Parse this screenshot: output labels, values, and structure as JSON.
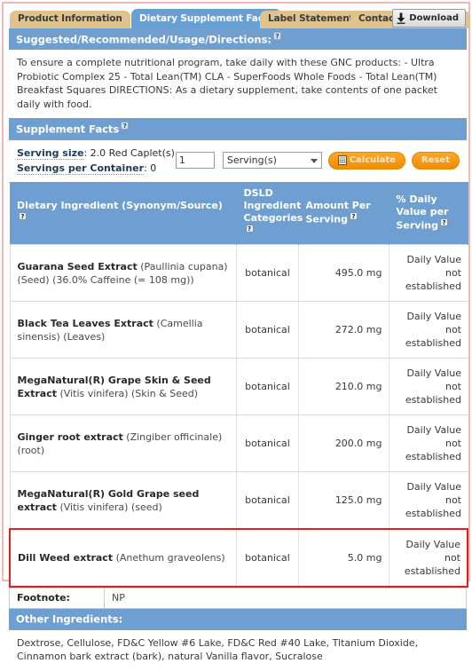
{
  "tabs": [
    {
      "label": "Product Information",
      "active": false
    },
    {
      "label": "Dietary Supplement Facts",
      "active": true
    },
    {
      "label": "Label Statements",
      "active": false
    },
    {
      "label": "Contact Information",
      "active": false
    }
  ],
  "download": {
    "label": "Download",
    "icon": "download-icon"
  },
  "sections": {
    "directions": {
      "title": "Suggested/Recommended/Usage/Directions:",
      "help": "?",
      "text": "To ensure a complete nutritional program, take daily with these GNC products: - Ultra Probiotic Complex 25 - Total Lean(TM) CLA - SuperFoods Whole Foods - Total Lean(TM) Breakfast Squares DIRECTIONS: As a dietary supplement, take contents of one packet daily with food."
    },
    "supplement_facts": {
      "title": "Supplement Facts",
      "help": "?"
    },
    "other_ingredients": {
      "title": "Other Ingredients:",
      "text": "Dextrose, Cellulose, FD&C Yellow #6 Lake, FD&C Red #40 Lake, Titanium Dioxide, Cinnamon bark extract (bark), natural Vanilla flavor, Sucralose"
    }
  },
  "serving": {
    "size_label": "Serving size",
    "size_value": ": 2.0 Red Caplet(s)",
    "per_container_label": "Servings per Container",
    "per_container_value": ": 0",
    "qty_value": "1",
    "unit_selected": "Serving(s)",
    "unit_options": [
      "Serving(s)"
    ],
    "calculate_label": "Calculate",
    "reset_label": "Reset"
  },
  "table": {
    "headers": {
      "ingredient": "Dietary Ingredient (Synonym/Source)",
      "categories": "DSLD Ingredient Categories",
      "amount": "Amount Per Serving",
      "daily_value": "% Daily Value per Serving"
    },
    "rows": [
      {
        "name": "Guarana Seed Extract",
        "synonym": " (Paullinia cupana) (Seed) (36.0% Caffeine (= 108 mg))",
        "category": "botanical",
        "amount": "495.0 mg",
        "daily_value": "Daily Value not established",
        "highlighted": false
      },
      {
        "name": "Black Tea Leaves Extract",
        "synonym": " (Camellia sinensis) (Leaves)",
        "category": "botanical",
        "amount": "272.0 mg",
        "daily_value": "Daily Value not established",
        "highlighted": false
      },
      {
        "name": "MegaNatural(R) Grape Skin & Seed Extract",
        "synonym": " (Vitis vinifera) (Skin & Seed)",
        "category": "botanical",
        "amount": "210.0 mg",
        "daily_value": "Daily Value not established",
        "highlighted": false
      },
      {
        "name": "Ginger root extract",
        "synonym": " (Zingiber officinale) (root)",
        "category": "botanical",
        "amount": "200.0 mg",
        "daily_value": "Daily Value not established",
        "highlighted": false
      },
      {
        "name": "MegaNatural(R) Gold Grape seed extract",
        "synonym": " (Vitis vinifera) (seed)",
        "category": "botanical",
        "amount": "125.0 mg",
        "daily_value": "Daily Value not established",
        "highlighted": false
      },
      {
        "name": "Dill Weed extract",
        "synonym": " (Anethum graveolens)",
        "category": "botanical",
        "amount": "5.0 mg",
        "daily_value": "Daily Value not established",
        "highlighted": true
      }
    ]
  },
  "footnote": {
    "label": "Footnote:",
    "value": "NP"
  },
  "colors": {
    "accent_blue": "#6e9fd0",
    "tab_inactive": "#dfc28c",
    "highlight_red": "#e02020",
    "frame_pink": "#f2b9b9",
    "button_orange": "#f08c00"
  }
}
